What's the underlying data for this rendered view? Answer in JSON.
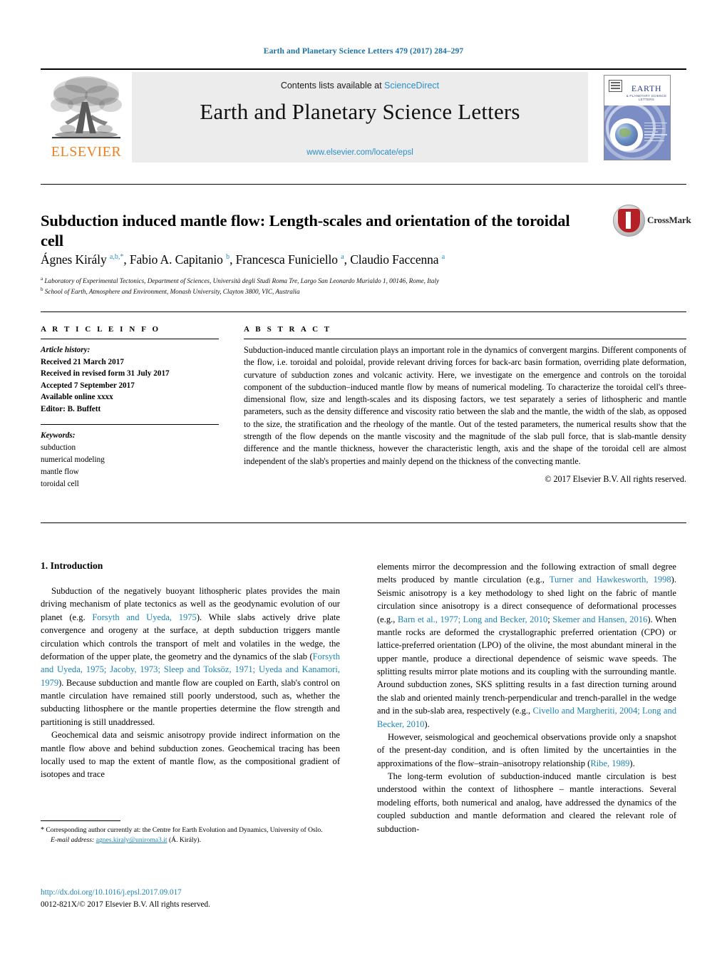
{
  "running_head": "Earth and Planetary Science Letters 479 (2017) 284–297",
  "masthead": {
    "publisher_name": "ELSEVIER",
    "contents_prefix": "Contents lists available at ",
    "contents_link": "ScienceDirect",
    "journal_name": "Earth and Planetary Science Letters",
    "journal_url": "www.elsevier.com/locate/epsl",
    "cover": {
      "title": "EARTH",
      "subtitle": "& PLANETARY SCIENCE LETTERS"
    }
  },
  "article": {
    "title": "Subduction induced mantle flow: Length-scales and orientation of the toroidal cell",
    "crossmark_label": "CrossMark",
    "authors_html": "Ágnes Király <sup>a,b,*</sup>, Fabio A. Capitanio <sup>b</sup>, Francesca Funiciello <sup>a</sup>, Claudio Faccenna <sup>a</sup>",
    "affiliations": [
      "Laboratory of Experimental Tectonics, Department of Sciences, Università degli Studi Roma Tre, Largo San Leonardo Murialdo 1, 00146, Rome, Italy",
      "School of Earth, Atmosphere and Environment, Monash University, Clayton 3800, VIC, Australia"
    ],
    "affiliation_marks": [
      "a",
      "b"
    ]
  },
  "article_info": {
    "heading": "A R T I C L E    I N F O",
    "history_label": "Article history:",
    "history": [
      "Received 21 March 2017",
      "Received in revised form 31 July 2017",
      "Accepted 7 September 2017",
      "Available online xxxx",
      "Editor: B. Buffett"
    ],
    "keywords_label": "Keywords:",
    "keywords": [
      "subduction",
      "numerical modeling",
      "mantle flow",
      "toroidal cell"
    ]
  },
  "abstract": {
    "heading": "A B S T R A C T",
    "text": "Subduction-induced mantle circulation plays an important role in the dynamics of convergent margins. Different components of the flow, i.e. toroidal and poloidal, provide relevant driving forces for back-arc basin formation, overriding plate deformation, curvature of subduction zones and volcanic activity. Here, we investigate on the emergence and controls on the toroidal component of the subduction–induced mantle flow by means of numerical modeling. To characterize the toroidal cell's three-dimensional flow, size and length-scales and its disposing factors, we test separately a series of lithospheric and mantle parameters, such as the density difference and viscosity ratio between the slab and the mantle, the width of the slab, as opposed to the size, the stratification and the rheology of the mantle. Out of the tested parameters, the numerical results show that the strength of the flow depends on the mantle viscosity and the magnitude of the slab pull force, that is slab-mantle density difference and the mantle thickness, however the characteristic length, axis and the shape of the toroidal cell are almost independent of the slab's properties and mainly depend on the thickness of the convecting mantle.",
    "copyright": "© 2017 Elsevier B.V. All rights reserved."
  },
  "body": {
    "section_title": "1. Introduction",
    "left_paragraphs": [
      {
        "runs": [
          {
            "t": "Subduction of the negatively buoyant lithospheric plates provides the main driving mechanism of plate tectonics as well as the geodynamic evolution of our planet (e.g. "
          },
          {
            "t": "Forsyth and Uyeda, 1975",
            "ref": true
          },
          {
            "t": "). While slabs actively drive plate convergence and orogeny at the surface, at depth subduction triggers mantle circulation which controls the transport of melt and volatiles in the wedge, the deformation of the upper plate, the geometry and the dynamics of the slab ("
          },
          {
            "t": "Forsyth and Uyeda, 1975; Jacoby, 1973; Sleep and Toksöz, 1971; Uyeda and Kanamori, 1979",
            "ref": true
          },
          {
            "t": "). Because subduction and mantle flow are coupled on Earth, slab's control on mantle circulation have remained still poorly understood, such as, whether the subducting lithosphere or the mantle properties determine the flow strength and partitioning is still unaddressed."
          }
        ]
      },
      {
        "runs": [
          {
            "t": "Geochemical data and seismic anisotropy provide indirect information on the mantle flow above and behind subduction zones. Geochemical tracing has been locally used to map the extent of mantle flow, as the compositional gradient of isotopes and trace"
          }
        ]
      }
    ],
    "right_paragraphs": [
      {
        "runs": [
          {
            "t": "elements mirror the decompression and the following extraction of small degree melts produced by mantle circulation (e.g., "
          },
          {
            "t": "Turner and Hawkesworth, 1998",
            "ref": true
          },
          {
            "t": "). Seismic anisotropy is a key methodology to shed light on the fabric of mantle circulation since anisotropy is a direct consequence of deformational processes (e.g., "
          },
          {
            "t": "Barn et al., 1977; Long and Becker, 2010",
            "ref": true
          },
          {
            "t": "; "
          },
          {
            "t": "Skemer and Hansen, 2016",
            "ref": true
          },
          {
            "t": "). When mantle rocks are deformed the crystallographic preferred orientation (CPO) or lattice-preferred orientation (LPO) of the olivine, the most abundant mineral in the upper mantle, produce a directional dependence of seismic wave speeds. The splitting results mirror plate motions and its coupling with the surrounding mantle. Around subduction zones, SKS splitting results in a fast direction turning around the slab and oriented mainly trench-perpendicular and trench-parallel in the wedge and in the sub-slab area, respectively (e.g., "
          },
          {
            "t": "Civello and Margheriti, 2004; Long and Becker, 2010",
            "ref": true
          },
          {
            "t": ")."
          }
        ]
      },
      {
        "runs": [
          {
            "t": "However, seismological and geochemical observations provide only a snapshot of the present-day condition, and is often limited by the uncertainties in the approximations of the flow–strain–anisotropy relationship ("
          },
          {
            "t": "Ribe, 1989",
            "ref": true
          },
          {
            "t": ")."
          }
        ]
      },
      {
        "runs": [
          {
            "t": "The long-term evolution of subduction-induced mantle circulation is best understood within the context of lithosphere – mantle interactions. Several modeling efforts, both numerical and analog, have addressed the dynamics of the coupled subduction and mantle deformation and cleared the relevant role of subduction-"
          }
        ]
      }
    ]
  },
  "footer": {
    "corresponding_note": "Corresponding author currently at: the Centre for Earth Evolution and Dynamics, University of Oslo.",
    "email_label": "E-mail address:",
    "email": "agnes.kiraly@uniroma3.it",
    "email_owner": "(Á. Király).",
    "doi": "http://dx.doi.org/10.1016/j.epsl.2017.09.017",
    "issn_line": "0012-821X/© 2017 Elsevier B.V. All rights reserved."
  },
  "colors": {
    "link": "#1b84b8",
    "running_head": "#1b72a8",
    "elsevier_orange": "#f07f20",
    "masthead_bg": "#ececec"
  }
}
